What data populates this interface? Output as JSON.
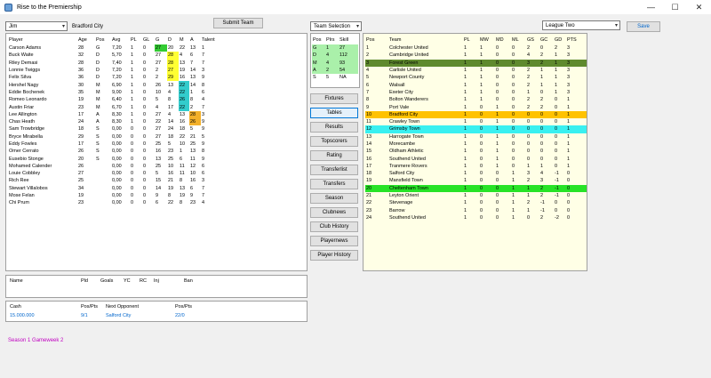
{
  "window": {
    "title": "Rise to the Premiership",
    "minimize": "—",
    "maximize": "☐",
    "close": "✕"
  },
  "manager": {
    "value": "Jim"
  },
  "team_name": "Bradford City",
  "submit_team": "Submit Team",
  "team_selection": {
    "value": "Team Selection"
  },
  "league_select": {
    "value": "League Two"
  },
  "save": "Save",
  "players": {
    "headers": [
      "Player",
      "Age",
      "Pos",
      "Avg",
      "PL",
      "GL",
      "G",
      "D",
      "M",
      "A",
      "Talent"
    ],
    "rows": [
      [
        "Carson Adams",
        "28",
        "G",
        "7,20",
        "1",
        "0",
        "27",
        "20",
        "22",
        "13",
        "1"
      ],
      [
        "Buck Waite",
        "32",
        "D",
        "5,70",
        "1",
        "0",
        "27",
        "28",
        "4",
        "6",
        "7"
      ],
      [
        "Riley Demasi",
        "28",
        "D",
        "7,40",
        "1",
        "0",
        "27",
        "28",
        "13",
        "7",
        "7"
      ],
      [
        "Lonnie Twiggs",
        "36",
        "D",
        "7,20",
        "1",
        "0",
        "2",
        "27",
        "19",
        "14",
        "3"
      ],
      [
        "Felix Silva",
        "36",
        "D",
        "7,20",
        "1",
        "0",
        "2",
        "29",
        "16",
        "13",
        "9"
      ],
      [
        "Hershel Nagy",
        "30",
        "M",
        "6,90",
        "1",
        "0",
        "26",
        "13",
        "22",
        "14",
        "8"
      ],
      [
        "Eddie Bochenek",
        "35",
        "M",
        "9,00",
        "1",
        "0",
        "10",
        "4",
        "22",
        "1",
        "6"
      ],
      [
        "Romeo Leonardo",
        "19",
        "M",
        "6,40",
        "1",
        "0",
        "5",
        "8",
        "26",
        "8",
        "4"
      ],
      [
        "Austin Friar",
        "23",
        "M",
        "6,70",
        "1",
        "0",
        "4",
        "17",
        "22",
        "2",
        "7"
      ],
      [
        "Lee Allington",
        "17",
        "A",
        "8,30",
        "1",
        "0",
        "27",
        "4",
        "13",
        "28",
        "3"
      ],
      [
        "Chas Heath",
        "24",
        "A",
        "8,30",
        "1",
        "0",
        "22",
        "14",
        "16",
        "26",
        "9"
      ],
      [
        "Sam Trowbridge",
        "18",
        "S",
        "0,00",
        "0",
        "0",
        "27",
        "24",
        "18",
        "5",
        "9"
      ],
      [
        "Bryce Mirabella",
        "29",
        "S",
        "0,00",
        "0",
        "0",
        "27",
        "18",
        "22",
        "21",
        "5"
      ],
      [
        "Eddy Fowles",
        "17",
        "S",
        "0,00",
        "0",
        "0",
        "25",
        "5",
        "10",
        "25",
        "9"
      ],
      [
        "Omer Cerrato",
        "26",
        "S",
        "0,00",
        "0",
        "0",
        "16",
        "23",
        "1",
        "13",
        "8"
      ],
      [
        "Eusebio Stonge",
        "20",
        "S",
        "0,00",
        "0",
        "0",
        "13",
        "25",
        "6",
        "11",
        "9"
      ],
      [
        "Mohamed Calender",
        "26",
        "",
        "0,00",
        "0",
        "0",
        "25",
        "10",
        "11",
        "12",
        "6"
      ],
      [
        "Louie Cobbley",
        "27",
        "",
        "0,00",
        "0",
        "0",
        "5",
        "16",
        "11",
        "10",
        "6"
      ],
      [
        "Rich Ree",
        "25",
        "",
        "0,00",
        "0",
        "0",
        "15",
        "21",
        "8",
        "16",
        "3"
      ],
      [
        "Stewart Villalobos",
        "34",
        "",
        "0,00",
        "0",
        "0",
        "14",
        "19",
        "13",
        "6",
        "7"
      ],
      [
        "Mose Felan",
        "19",
        "",
        "0,00",
        "0",
        "0",
        "9",
        "8",
        "19",
        "9",
        "7"
      ],
      [
        "Chi Prum",
        "23",
        "",
        "0,00",
        "0",
        "0",
        "6",
        "22",
        "8",
        "23",
        "4"
      ]
    ]
  },
  "formation": {
    "headers": [
      "Pos",
      "Plrs",
      "Skill"
    ],
    "rows": [
      [
        "G",
        "1",
        "27"
      ],
      [
        "D",
        "4",
        "112"
      ],
      [
        "M",
        "4",
        "93"
      ],
      [
        "A",
        "2",
        "54"
      ],
      [
        "S",
        "5",
        "NA"
      ]
    ]
  },
  "nav_buttons": [
    "Fixtures",
    "Tables",
    "Results",
    "Topscorers",
    "Rating",
    "Transferlist",
    "Transfers",
    "Season",
    "Clubnews",
    "Club History",
    "Playernews",
    "Player History"
  ],
  "league_table": {
    "headers": [
      "Pos",
      "Team",
      "PL",
      "MW",
      "MD",
      "ML",
      "GS",
      "GC",
      "GD",
      "PTS"
    ],
    "rows": [
      [
        "1",
        "Colchester United",
        "1",
        "1",
        "0",
        "0",
        "2",
        "0",
        "2",
        "3"
      ],
      [
        "2",
        "Cambridge United",
        "1",
        "1",
        "0",
        "0",
        "4",
        "2",
        "1",
        "3"
      ],
      [
        "3",
        "Forest Green",
        "1",
        "1",
        "0",
        "0",
        "3",
        "2",
        "1",
        "3"
      ],
      [
        "4",
        "Carlisle United",
        "1",
        "1",
        "0",
        "0",
        "2",
        "1",
        "1",
        "3"
      ],
      [
        "5",
        "Newport County",
        "1",
        "1",
        "0",
        "0",
        "2",
        "1",
        "1",
        "3"
      ],
      [
        "6",
        "Walsall",
        "1",
        "1",
        "0",
        "0",
        "2",
        "1",
        "1",
        "3"
      ],
      [
        "7",
        "Exeter City",
        "1",
        "1",
        "0",
        "0",
        "1",
        "0",
        "1",
        "3"
      ],
      [
        "8",
        "Bolton Wanderers",
        "1",
        "1",
        "0",
        "0",
        "2",
        "2",
        "0",
        "1"
      ],
      [
        "9",
        "Port Vale",
        "1",
        "0",
        "1",
        "0",
        "2",
        "2",
        "0",
        "1"
      ],
      [
        "10",
        "Bradford City",
        "1",
        "0",
        "1",
        "0",
        "0",
        "0",
        "0",
        "1"
      ],
      [
        "11",
        "Crawley Town",
        "1",
        "0",
        "1",
        "0",
        "0",
        "0",
        "0",
        "1"
      ],
      [
        "12",
        "Grimsby Town",
        "1",
        "0",
        "1",
        "0",
        "0",
        "0",
        "0",
        "1"
      ],
      [
        "13",
        "Harrogate Town",
        "1",
        "0",
        "1",
        "0",
        "0",
        "0",
        "0",
        "1"
      ],
      [
        "14",
        "Morecambe",
        "1",
        "0",
        "1",
        "0",
        "0",
        "0",
        "0",
        "1"
      ],
      [
        "15",
        "Oldham Athletic",
        "1",
        "0",
        "1",
        "0",
        "0",
        "0",
        "0",
        "1"
      ],
      [
        "16",
        "Southend United",
        "1",
        "0",
        "1",
        "0",
        "0",
        "0",
        "0",
        "1"
      ],
      [
        "17",
        "Tranmere Rovers",
        "1",
        "0",
        "1",
        "0",
        "1",
        "1",
        "0",
        "1"
      ],
      [
        "18",
        "Salford City",
        "1",
        "0",
        "0",
        "1",
        "3",
        "4",
        "-1",
        "0"
      ],
      [
        "19",
        "Mansfield Town",
        "1",
        "0",
        "0",
        "1",
        "2",
        "3",
        "-1",
        "0"
      ],
      [
        "20",
        "Cheltenham Town",
        "1",
        "0",
        "0",
        "1",
        "1",
        "2",
        "-1",
        "0"
      ],
      [
        "21",
        "Leyton Orient",
        "1",
        "0",
        "0",
        "1",
        "1",
        "2",
        "-1",
        "0"
      ],
      [
        "22",
        "Stevenage",
        "1",
        "0",
        "0",
        "1",
        "2",
        "-1",
        "0",
        "0"
      ],
      [
        "23",
        "Barrow",
        "1",
        "0",
        "0",
        "1",
        "1",
        "-1",
        "0",
        "0"
      ],
      [
        "24",
        "Southend United",
        "1",
        "0",
        "0",
        "1",
        "0",
        "2",
        "-2",
        "0"
      ]
    ]
  },
  "stats_headers": [
    "Name",
    "Pld",
    "Goals",
    "YC",
    "RC",
    "Inj",
    "Ban"
  ],
  "finance": {
    "headers": [
      "Cash",
      "Pos/Pts",
      "Next Opponent",
      "Pos/Pts"
    ],
    "values": [
      "15.000.000",
      "9/1",
      "Salford City",
      "22/0"
    ]
  },
  "status": "Season 1 Gameweek 2",
  "colors": {
    "accent": "#0078d7",
    "status": "#c000c0",
    "finance_text": "#0066cc"
  }
}
